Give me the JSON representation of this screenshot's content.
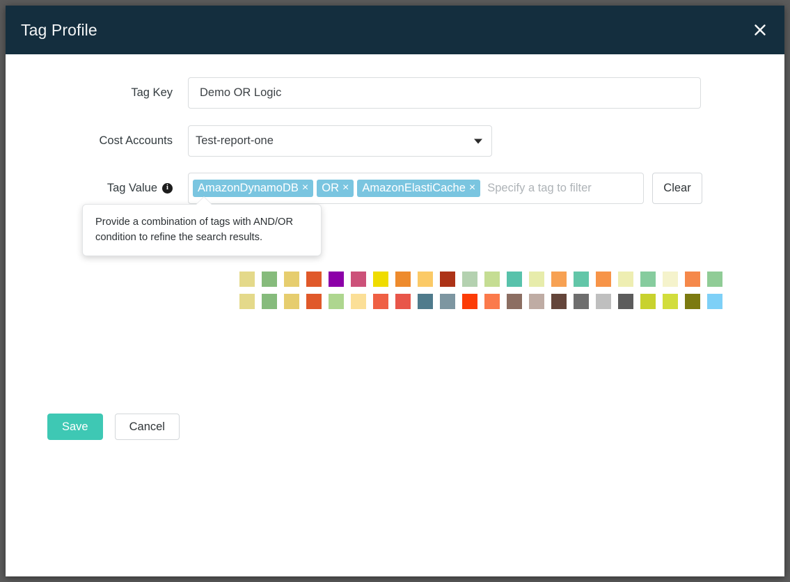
{
  "modal": {
    "title": "Tag Profile",
    "close_icon": "close-icon",
    "header_bg": "#142e3e"
  },
  "form": {
    "tag_key": {
      "label": "Tag Key",
      "value": "Demo OR Logic",
      "placeholder": ""
    },
    "cost_accounts": {
      "label": "Cost Accounts",
      "value": "Test-report-one",
      "caret_icon": "chevron-down-icon"
    },
    "tag_value": {
      "label": "Tag Value",
      "info_icon": "info-icon",
      "info_glyph": "i",
      "placeholder": "Specify a tag to filter",
      "clear_label": "Clear",
      "chips": [
        {
          "label": "AmazonDynamoDB",
          "remove_glyph": "×"
        },
        {
          "label": "OR",
          "remove_glyph": "×"
        },
        {
          "label": "AmazonElastiCache",
          "remove_glyph": "×"
        }
      ],
      "chip_color": "#7ac5e0"
    }
  },
  "tooltip": {
    "text": "Provide a combination of tags with AND/OR condition to refine the search results."
  },
  "color_picker": {
    "selected_index": 44,
    "rows": [
      [
        "#e4d98a",
        "#86bb7c",
        "#e6cd6e",
        "#e0592a",
        "#8c00a8",
        "#cc5179",
        "#efdc00",
        "#ee8b2d",
        "#fbca67",
        "#ad3317",
        "#b4d1b0",
        "#c5dd93",
        "#58c2ab",
        "#e7ecab",
        "#f7a153",
        "#62c6a8",
        "#f79448",
        "#eeeeb2",
        "#86cc9e",
        "#f5f3cc",
        "#f5884a",
        "#90cc96"
      ],
      [
        "#e4d98a",
        "#86bb7c",
        "#e6cd6e",
        "#e0592a",
        "#aed68f",
        "#fbdf97",
        "#ef6044",
        "#e8564a",
        "#4f7b8c",
        "#7d96a1",
        "#fc3c06",
        "#fb7a4b",
        "#8c6e62",
        "#bfaca4",
        "#64453a",
        "#6e6e6e",
        "#bfbfbf",
        "#5c5c5c",
        "#c8d22e",
        "#d2dd3c",
        "#7c7a10",
        "#7ed0f7"
      ]
    ]
  },
  "footer": {
    "save_label": "Save",
    "cancel_label": "Cancel",
    "save_color": "#3ec8b4"
  }
}
